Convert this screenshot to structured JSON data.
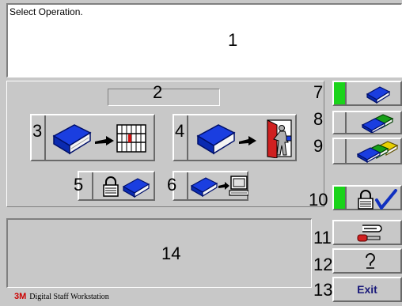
{
  "message_panel": {
    "text": "Select Operation."
  },
  "callouts": {
    "c1": "1",
    "c2": "2",
    "c3": "3",
    "c4": "4",
    "c5": "5",
    "c6": "6",
    "c7": "7",
    "c8": "8",
    "c9": "9",
    "c10": "10",
    "c11": "11",
    "c12": "12",
    "c13": "13",
    "c14": "14"
  },
  "buttons": {
    "checkin_icon": "book-to-shelf-icon",
    "checkout_icon": "book-to-patron-door-icon",
    "secure_icon": "lock-book-icon",
    "sendto_computer_icon": "book-to-computer-icon",
    "single_book_icon": "blue-book-icon",
    "two_books_icon": "two-books-icon",
    "three_books_icon": "three-books-icon",
    "lock_check_icon": "lock-checkmark-icon",
    "tools_icon": "tools-icon",
    "help_icon": "question-mark-icon",
    "exit_label": "Exit"
  },
  "indicators": {
    "single_book_active": true,
    "two_books_active": false,
    "three_books_active": false,
    "lock_check_active": true,
    "active_color": "#1ad31a"
  },
  "footer": {
    "logo": "3M",
    "text": "Digital Staff Workstation"
  }
}
